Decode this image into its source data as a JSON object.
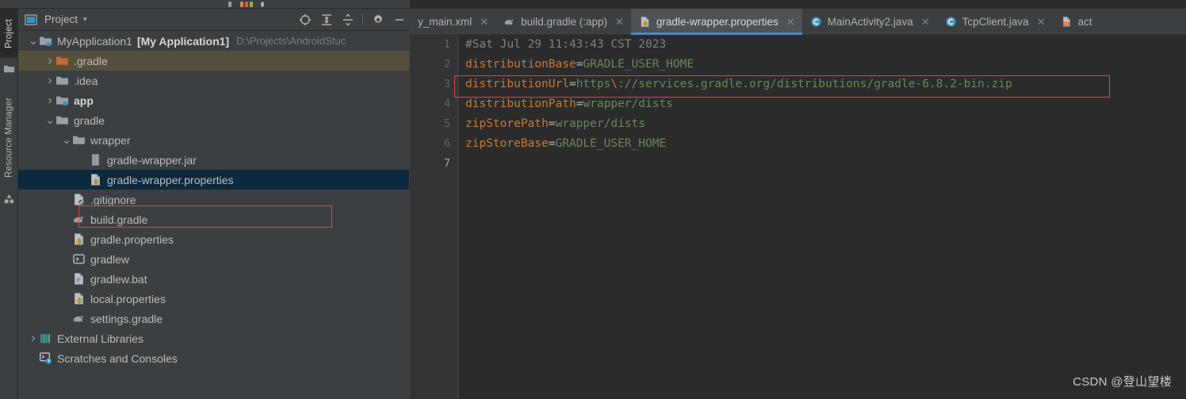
{
  "window": {
    "theme": "darcula",
    "accent": "#4a88c7",
    "panel_bg": "#3c3f41",
    "editor_bg": "#2b2b2b",
    "selection_bg": "#0d293e",
    "hover_bg": "#55503c",
    "annotation_color": "#e8433f"
  },
  "left_toolbar": {
    "tabs": [
      {
        "label": "Project",
        "selected": true,
        "icon": "project-icon"
      },
      {
        "label": "Resource Manager",
        "selected": false,
        "icon": "resource-manager-icon"
      }
    ]
  },
  "project_panel": {
    "title": "Project",
    "dropdown_caret": "▾",
    "tools": [
      {
        "name": "locate-icon",
        "glyph": "⊕"
      },
      {
        "name": "expand-all-icon",
        "glyph": "⤓"
      },
      {
        "name": "collapse-all-icon",
        "glyph": "⤒"
      },
      {
        "name": "settings-gear-icon",
        "glyph": "⚙"
      },
      {
        "name": "hide-icon",
        "glyph": "—"
      }
    ],
    "tree": [
      {
        "label": "MyApplication1",
        "bold_label": "[My Application1]",
        "sub": "D:\\Projects\\AndroidStuc",
        "indent": 0,
        "arrow": "expanded",
        "icon": "module-folder-icon",
        "state": "normal"
      },
      {
        "label": ".gradle",
        "indent": 1,
        "arrow": "collapsed",
        "icon": "folder-orange-icon",
        "state": "hover"
      },
      {
        "label": ".idea",
        "indent": 1,
        "arrow": "collapsed",
        "icon": "folder-icon",
        "state": "normal"
      },
      {
        "label": "app",
        "indent": 1,
        "arrow": "collapsed",
        "icon": "module-folder-icon",
        "bold": true,
        "state": "normal"
      },
      {
        "label": "gradle",
        "indent": 1,
        "arrow": "expanded",
        "icon": "folder-icon",
        "state": "normal"
      },
      {
        "label": "wrapper",
        "indent": 2,
        "arrow": "expanded",
        "icon": "folder-icon",
        "state": "normal"
      },
      {
        "label": "gradle-wrapper.jar",
        "indent": 3,
        "arrow": "none",
        "icon": "jar-icon",
        "state": "normal"
      },
      {
        "label": "gradle-wrapper.properties",
        "indent": 3,
        "arrow": "none",
        "icon": "properties-icon",
        "state": "selected"
      },
      {
        "label": ".gitignore",
        "indent": 2,
        "arrow": "none",
        "icon": "gitignore-icon",
        "state": "normal"
      },
      {
        "label": "build.gradle",
        "indent": 2,
        "arrow": "none",
        "icon": "gradle-icon",
        "state": "normal"
      },
      {
        "label": "gradle.properties",
        "indent": 2,
        "arrow": "none",
        "icon": "properties-icon",
        "state": "normal"
      },
      {
        "label": "gradlew",
        "indent": 2,
        "arrow": "none",
        "icon": "shell-script-icon",
        "state": "normal"
      },
      {
        "label": "gradlew.bat",
        "indent": 2,
        "arrow": "none",
        "icon": "bat-file-icon",
        "state": "normal"
      },
      {
        "label": "local.properties",
        "indent": 2,
        "arrow": "none",
        "icon": "properties-icon",
        "state": "normal"
      },
      {
        "label": "settings.gradle",
        "indent": 2,
        "arrow": "none",
        "icon": "gradle-icon",
        "state": "normal"
      },
      {
        "label": "External Libraries",
        "indent": 0,
        "arrow": "collapsed",
        "icon": "libraries-icon",
        "state": "normal"
      },
      {
        "label": "Scratches and Consoles",
        "indent": 0,
        "arrow": "none",
        "icon": "scratches-icon",
        "state": "normal"
      }
    ]
  },
  "editor": {
    "tabs": [
      {
        "label": "y_main.xml",
        "icon": "layout-xml-icon",
        "active": false,
        "closable": true,
        "truncated_left": true
      },
      {
        "label": "build.gradle (:app)",
        "icon": "gradle-icon",
        "active": false,
        "closable": true
      },
      {
        "label": "gradle-wrapper.properties",
        "icon": "properties-icon",
        "active": true,
        "closable": true
      },
      {
        "label": "MainActivity2.java",
        "icon": "java-class-icon",
        "active": false,
        "closable": true
      },
      {
        "label": "TcpClient.java",
        "icon": "java-class-icon",
        "active": false,
        "closable": true
      },
      {
        "label": "act",
        "icon": "xml-file-icon",
        "active": false,
        "closable": false,
        "truncated_right": true
      }
    ],
    "line_numbers": [
      "1",
      "2",
      "3",
      "4",
      "5",
      "6",
      "7"
    ],
    "current_line": 7,
    "lines": [
      {
        "type": "comment",
        "text": "#Sat Jul 29 11:43:43 CST 2023"
      },
      {
        "type": "property",
        "key": "distributionBase",
        "value": "GRADLE_USER_HOME"
      },
      {
        "type": "property",
        "key": "distributionUrl",
        "value": "https\\://services.gradle.org/distributions/gradle-6.8.2-bin.zip",
        "highlighted": true
      },
      {
        "type": "property",
        "key": "distributionPath",
        "value": "wrapper/dists"
      },
      {
        "type": "property",
        "key": "zipStorePath",
        "value": "wrapper/dists"
      },
      {
        "type": "property",
        "key": "zipStoreBase",
        "value": "GRADLE_USER_HOME"
      },
      {
        "type": "empty",
        "text": ""
      }
    ]
  },
  "watermark": {
    "text": "CSDN @登山望楼"
  }
}
